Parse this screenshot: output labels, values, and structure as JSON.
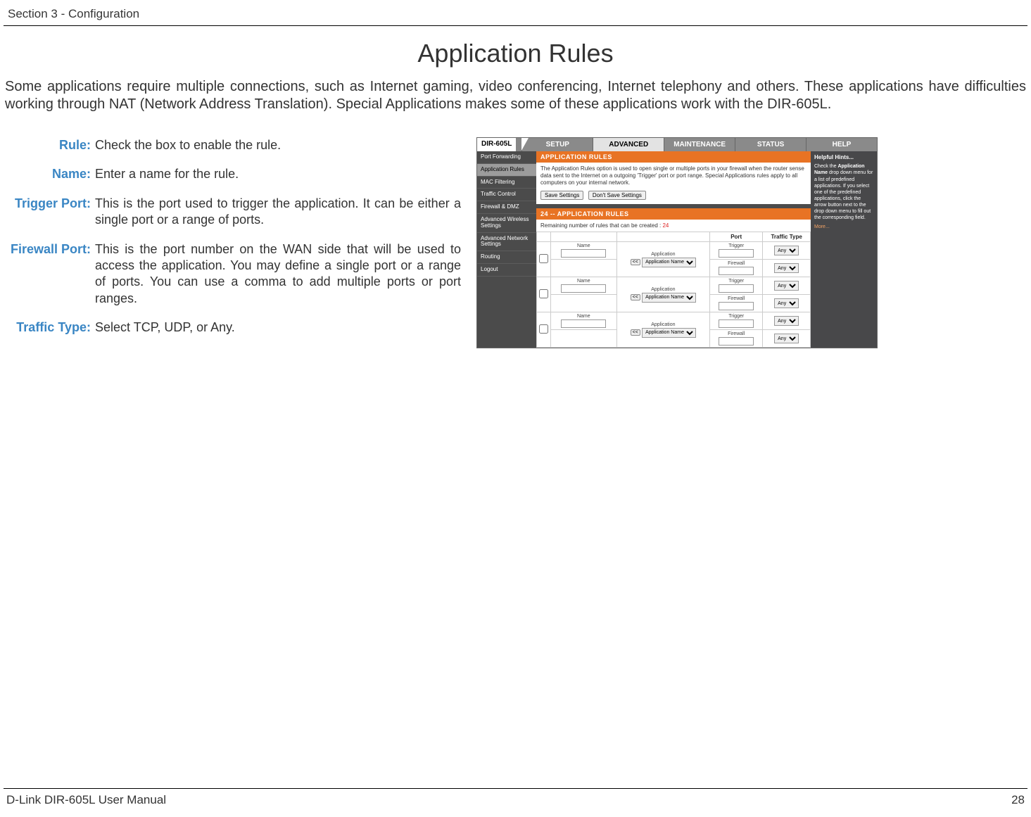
{
  "header": {
    "section": "Section 3 - Configuration"
  },
  "title": "Application Rules",
  "intro": "Some applications require multiple connections, such as Internet gaming, video conferencing, Internet telephony and others. These applications have difficulties working through NAT (Network Address Translation). Special Applications makes some of these applications work with the DIR-605L.",
  "definitions": [
    {
      "label": "Rule:",
      "text": "Check the box to enable the rule."
    },
    {
      "label": "Name:",
      "text": "Enter a name for the rule."
    },
    {
      "label": "Trigger Port:",
      "text": "This is the port used to trigger the application. It can be either a single port or a range of ports."
    },
    {
      "label": "Firewall Port:",
      "text": "This is the port number on the WAN side that will be used to access the application. You may define a single port or a range of ports. You can use a comma to add multiple ports or port ranges."
    },
    {
      "label": "Traffic Type:",
      "text": "Select TCP, UDP, or Any."
    }
  ],
  "screenshot": {
    "model": "DIR-605L",
    "tabs": [
      "SETUP",
      "ADVANCED",
      "MAINTENANCE",
      "STATUS",
      "HELP"
    ],
    "active_tab": "ADVANCED",
    "sidebar": [
      "Port Forwarding",
      "Application Rules",
      "MAC Filtering",
      "Traffic Control",
      "Firewall & DMZ",
      "Advanced Wireless Settings",
      "Advanced Network Settings",
      "Routing",
      "Logout"
    ],
    "active_side": "Application Rules",
    "panel_title_1": "APPLICATION RULES",
    "panel_desc": "The Application Rules option is used to open single or multiple ports in your firewall when the router sense data sent to the Internet on a outgoing 'Trigger' port or port range. Special Applications rules apply to all computers on your internal network.",
    "buttons": {
      "save": "Save Settings",
      "dont": "Don't Save Settings"
    },
    "panel_title_2": "24 -- APPLICATION RULES",
    "remaining_label": "Remaining number of rules that can be created :",
    "remaining_value": "24",
    "headers": {
      "port": "Port",
      "traffic": "Traffic Type"
    },
    "row_labels": {
      "name": "Name",
      "app": "Application",
      "trigger": "Trigger",
      "firewall": "Firewall"
    },
    "app_select": "Application Name",
    "arrow": "<<",
    "any": "Any",
    "hints": {
      "title": "Helpful Hints...",
      "body_pre": "Check the ",
      "body_bold": "Application Name",
      "body_post": " drop down menu for a list of predefined applications. If you select one of the predefined applications, click the arrow button next to the drop down menu to fill out the corresponding field.",
      "more": "More..."
    }
  },
  "footer": {
    "manual": "D-Link DIR-605L User Manual",
    "page": "28"
  }
}
